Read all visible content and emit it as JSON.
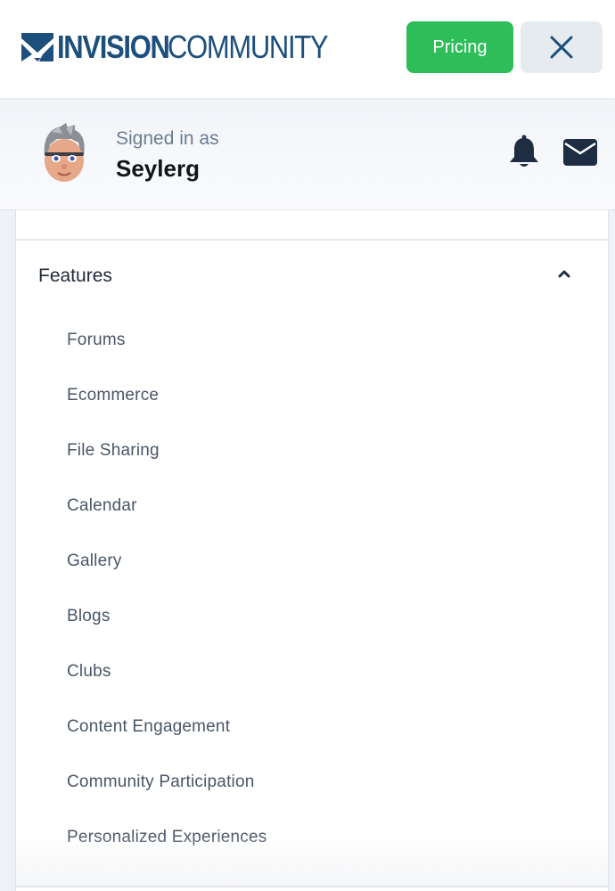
{
  "header": {
    "logo_bold": "INVISION",
    "logo_light": "COMMUNITY",
    "pricing_label": "Pricing",
    "close_icon": "close-icon",
    "brand_color": "#1d4f7c",
    "pricing_color": "#2ebd59"
  },
  "user": {
    "signed_in_label": "Signed in as",
    "username": "Seylerg",
    "notification_icon": "bell-icon",
    "messages_icon": "envelope-icon"
  },
  "menu": {
    "section_title": "Features",
    "expanded": true,
    "items": [
      {
        "label": "Forums"
      },
      {
        "label": "Ecommerce"
      },
      {
        "label": "File Sharing"
      },
      {
        "label": "Calendar"
      },
      {
        "label": "Gallery"
      },
      {
        "label": "Blogs"
      },
      {
        "label": "Clubs"
      },
      {
        "label": "Content Engagement"
      },
      {
        "label": "Community Participation"
      },
      {
        "label": "Personalized Experiences"
      }
    ]
  }
}
